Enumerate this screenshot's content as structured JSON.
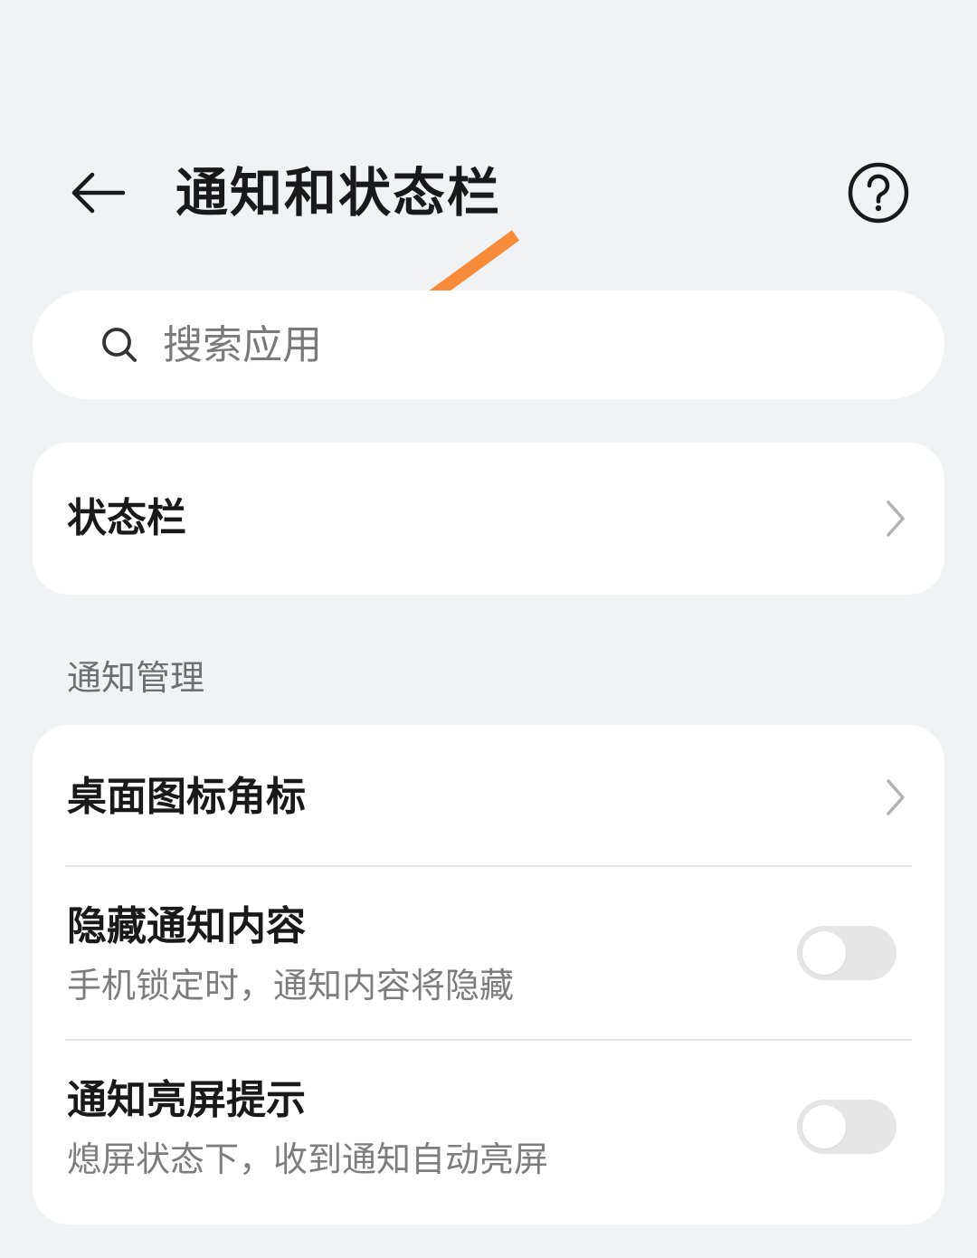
{
  "header": {
    "title": "通知和状态栏",
    "back_icon": "arrow-left-icon",
    "help_icon": "question-circle-icon"
  },
  "search": {
    "placeholder": "搜索应用",
    "value": "",
    "icon": "search-icon"
  },
  "annotation": {
    "color": "#f88b3a",
    "icon": "arrow-annotation-icon"
  },
  "status_bar_card": {
    "label": "状态栏"
  },
  "notification_section": {
    "label": "通知管理",
    "items": [
      {
        "title": "桌面图标角标",
        "type": "chevron"
      },
      {
        "title": "隐藏通知内容",
        "subtitle": "手机锁定时，通知内容将隐藏",
        "type": "toggle",
        "on": false
      },
      {
        "title": "通知亮屏提示",
        "subtitle": "熄屏状态下，收到通知自动亮屏",
        "type": "toggle",
        "on": false
      }
    ]
  },
  "colors": {
    "background": "#f1f2f4",
    "card": "#ffffff",
    "toggle_off": "#e6e6e6",
    "accent_annotation": "#f88b3a"
  }
}
